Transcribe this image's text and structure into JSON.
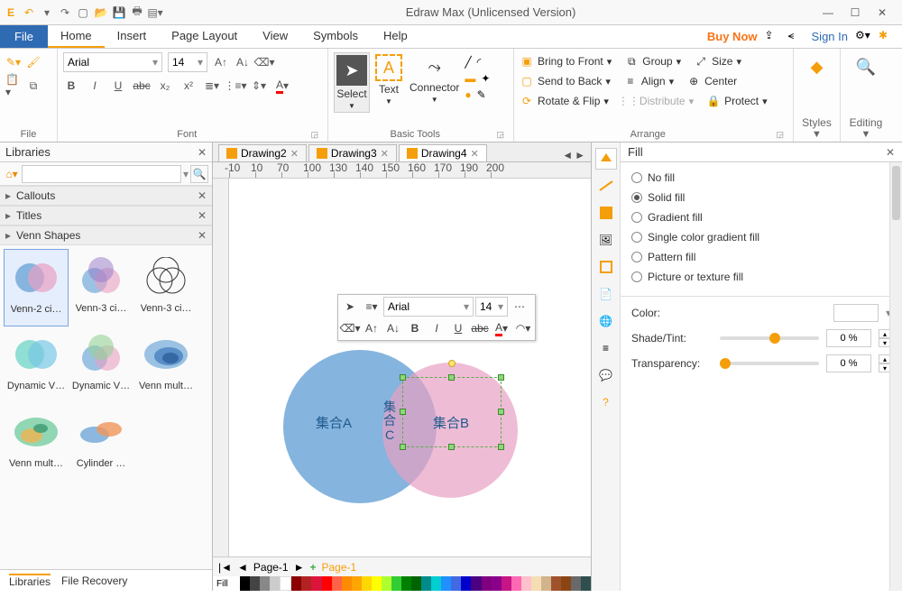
{
  "window": {
    "title": "Edraw Max (Unlicensed Version)"
  },
  "menu": {
    "file": "File",
    "tabs": [
      "Home",
      "Insert",
      "Page Layout",
      "View",
      "Symbols",
      "Help"
    ],
    "active": "Home",
    "buynow": "Buy Now",
    "signin": "Sign In"
  },
  "ribbon": {
    "file_group": "File",
    "font_group": "Font",
    "font_name": "Arial",
    "font_size": "14",
    "basic_tools": "Basic Tools",
    "select": "Select",
    "text": "Text",
    "connector": "Connector",
    "arrange_group": "Arrange",
    "bring_front": "Bring to Front",
    "send_back": "Send to Back",
    "rotate_flip": "Rotate & Flip",
    "group": "Group",
    "align": "Align",
    "distribute": "Distribute",
    "size": "Size",
    "center": "Center",
    "protect": "Protect",
    "styles": "Styles",
    "editing": "Editing"
  },
  "libraries": {
    "title": "Libraries",
    "sections": {
      "callouts": "Callouts",
      "titles": "Titles",
      "venn": "Venn Shapes"
    },
    "shapes": [
      "Venn-2 ci…",
      "Venn-3 ci…",
      "Venn-3 ci…",
      "Dynamic V…",
      "Dynamic V…",
      "Venn mult…",
      "Venn mult…",
      "Cylinder …"
    ],
    "tabs": {
      "lib": "Libraries",
      "rec": "File Recovery"
    }
  },
  "doctabs": [
    "Drawing2",
    "Drawing3",
    "Drawing4"
  ],
  "doctab_active": "Drawing4",
  "ruler_marks": [
    "-10",
    "10",
    "70",
    "100",
    "130",
    "140",
    "150",
    "160",
    "170",
    "190",
    "200"
  ],
  "float_toolbar": {
    "font": "Arial",
    "size": "14"
  },
  "venn": {
    "A": "集合A",
    "B": "集合B",
    "C": "集\n合\nC"
  },
  "pagebar": {
    "page": "Page-1",
    "fill": "Fill",
    "current": "Page-1"
  },
  "fill": {
    "title": "Fill",
    "opts": [
      "No fill",
      "Solid fill",
      "Gradient fill",
      "Single color gradient fill",
      "Pattern fill",
      "Picture or texture fill"
    ],
    "selected": "Solid fill",
    "color": "Color:",
    "shade": "Shade/Tint:",
    "shade_val": "0 %",
    "trans": "Transparency:",
    "trans_val": "0 %"
  },
  "colors": {
    "accent": "#f59e0b",
    "blue": "#5c9bd3",
    "pink": "#e8a0c3"
  }
}
